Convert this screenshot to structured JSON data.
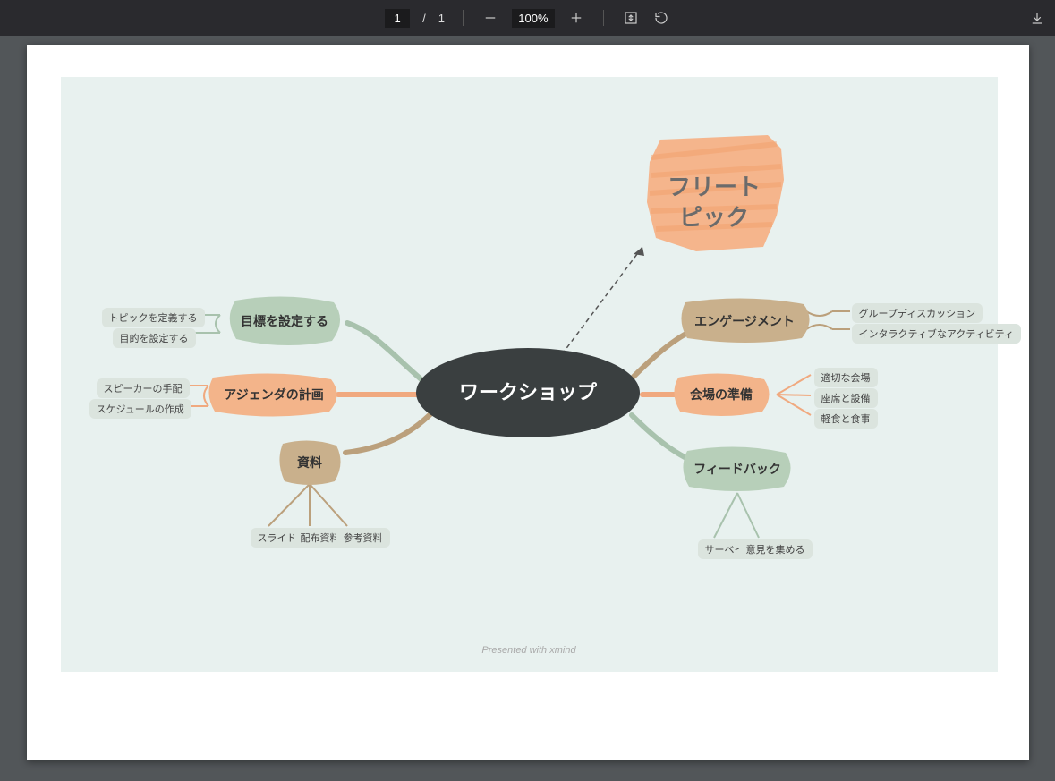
{
  "toolbar": {
    "page_current": "1",
    "page_sep": "/",
    "page_total": "1",
    "zoom": "100%"
  },
  "footer": "Presented with xmind",
  "center": "ワークショップ",
  "floating": {
    "line1": "フリート",
    "line2": "ピック"
  },
  "left": {
    "goals": {
      "label": "目標を設定する",
      "children": [
        "トピックを定義する",
        "目的を設定する"
      ]
    },
    "agenda": {
      "label": "アジェンダの計画",
      "children": [
        "スピーカーの手配",
        "スケジュールの作成"
      ]
    },
    "materials": {
      "label": "資料",
      "children": [
        "スライド",
        "配布資料",
        "参考資料"
      ]
    }
  },
  "right": {
    "engagement": {
      "label": "エンゲージメント",
      "children": [
        "グループディスカッション",
        "インタラクティブなアクティビティ"
      ]
    },
    "venue": {
      "label": "会場の準備",
      "children": [
        "適切な会場",
        "座席と設備",
        "軽食と食事"
      ]
    },
    "feedback": {
      "label": "フィードバック",
      "children": [
        "サーベイ",
        "意見を集める"
      ]
    }
  }
}
